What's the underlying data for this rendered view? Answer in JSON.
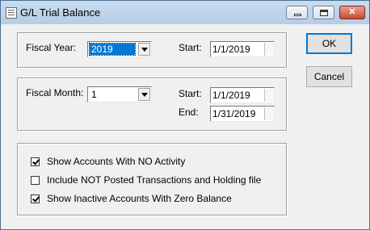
{
  "window": {
    "title": "G/L Trial Balance",
    "controls": {
      "minimize": "",
      "maximize": "",
      "close": "✕"
    }
  },
  "fiscal_year": {
    "label": "Fiscal Year:",
    "value": "2019",
    "start_label": "Start:",
    "start_value": "1/1/2019"
  },
  "fiscal_month": {
    "label": "Fiscal Month:",
    "value": "1",
    "start_label": "Start:",
    "start_value": "1/1/2019",
    "end_label": "End:",
    "end_value": "1/31/2019"
  },
  "options": [
    {
      "label": "Show Accounts With NO Activity",
      "checked": true
    },
    {
      "label": "Include NOT Posted Transactions and Holding file",
      "checked": false
    },
    {
      "label": "Show Inactive Accounts With Zero Balance",
      "checked": true
    }
  ],
  "buttons": {
    "ok": "OK",
    "cancel": "Cancel"
  }
}
